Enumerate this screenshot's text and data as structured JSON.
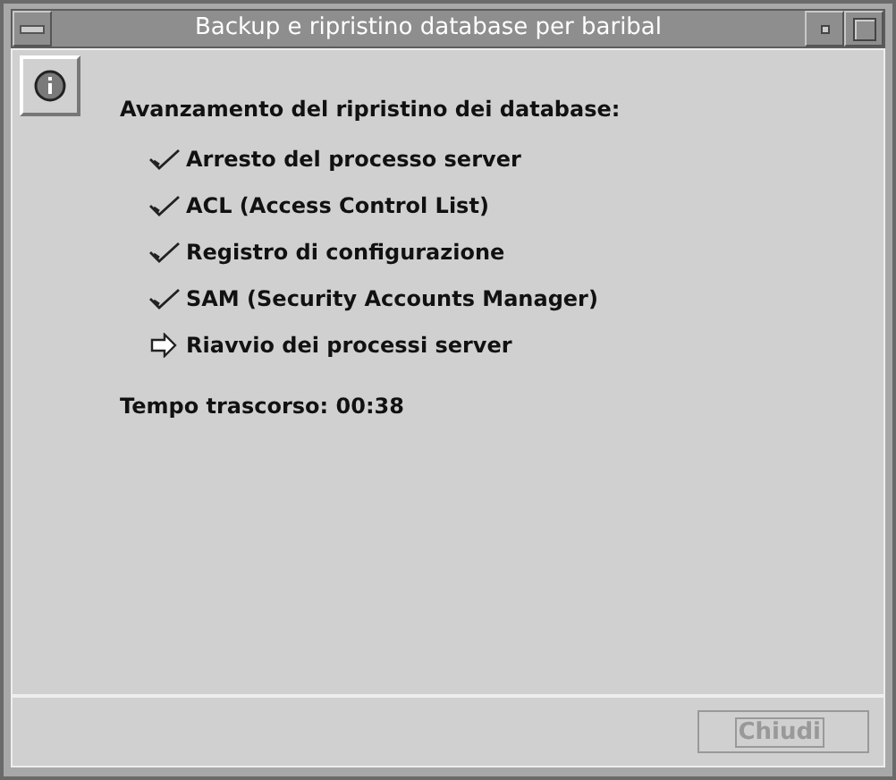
{
  "window": {
    "title": "Backup e ripristino database per baribal"
  },
  "heading": "Avanzamento del ripristino dei database:",
  "steps": [
    {
      "label": "Arresto del processo server",
      "kind": "done"
    },
    {
      "label": "ACL (Access Control List)",
      "kind": "done"
    },
    {
      "label": "Registro di configurazione",
      "kind": "done"
    },
    {
      "label": "SAM (Security Accounts Manager)",
      "kind": "done"
    },
    {
      "label": "Riavvio dei processi server",
      "kind": "current"
    }
  ],
  "elapsed": "Tempo trascorso: 00:38",
  "close_button": {
    "label": "Chiudi",
    "disabled": true
  }
}
